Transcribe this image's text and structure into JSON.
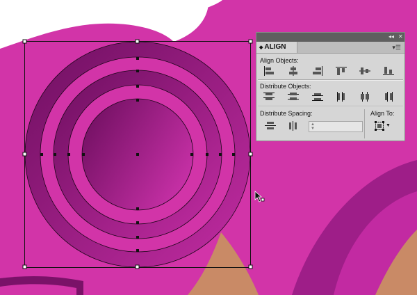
{
  "colors": {
    "magenta": "#d234a8",
    "dark_purple": "#7a1268",
    "mid_purple": "#a21f8c",
    "orange": "#c98a66",
    "panel_bg": "#d6d6d6"
  },
  "panel": {
    "title": "ALIGN",
    "align_objects_label": "Align Objects:",
    "distribute_objects_label": "Distribute Objects:",
    "distribute_spacing_label": "Distribute Spacing:",
    "align_to_label": "Align To:",
    "spacing_value": "",
    "menu_icon": "panel-menu-icon",
    "collapse_icon": "collapse-icon",
    "close_icon": "close-icon"
  },
  "icons": {
    "align_objects": [
      "align-left-icon",
      "align-horizontal-center-icon",
      "align-right-icon",
      "align-top-icon",
      "align-vertical-center-icon",
      "align-bottom-icon"
    ],
    "distribute_objects": [
      "distribute-top-icon",
      "distribute-vertical-center-icon",
      "distribute-bottom-icon",
      "distribute-left-icon",
      "distribute-horizontal-center-icon",
      "distribute-right-icon"
    ],
    "distribute_spacing": [
      "distribute-vertical-space-icon",
      "distribute-horizontal-space-icon"
    ]
  }
}
